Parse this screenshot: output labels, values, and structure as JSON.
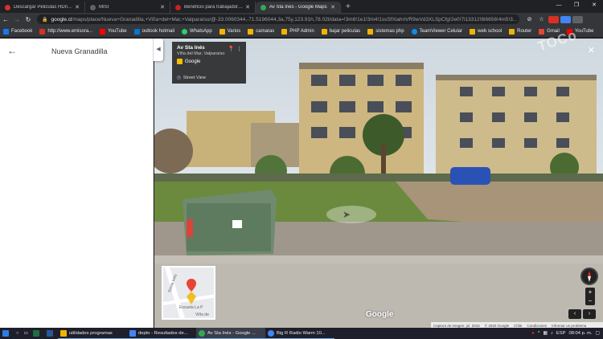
{
  "tabs": [
    {
      "label": "Descargar Peliculas HDrip por To...",
      "color": "#d93025",
      "active": false
    },
    {
      "label": "MISI",
      "color": "#5f6368",
      "active": false
    },
    {
      "label": "Beneficio para trabajadores indep...",
      "color": "#c5221f",
      "active": false
    },
    {
      "label": "Av Sta Inés - Google Maps",
      "color": "#34a853",
      "active": true
    }
  ],
  "new_tab_label": "+",
  "window_controls": {
    "minimize": "—",
    "maximize": "❐",
    "close": "✕"
  },
  "address": {
    "host": "google.cl",
    "path": "/maps/place/Nueva+Granadilla,+Viña+del+Mar,+Valparaíso/@-33.0060344,-71.5196044,3a,75y,123.91h,78.02t/data=!3m6!1e1!3m4!1ssSfXiahnVR9wVd3XLSpCfg!2e0!7i13312!8i6656!4m5!3..."
  },
  "bookmarks": [
    {
      "label": "Facebook",
      "color": "#1877f2"
    },
    {
      "label": "http://www.emisora...",
      "color": "#d93025"
    },
    {
      "label": "YouTube",
      "color": "#ff0000"
    },
    {
      "label": "outlook hotmail",
      "color": "#0078d4"
    },
    {
      "label": "WhatsApp",
      "color": "#25d366"
    },
    {
      "label": "Varios",
      "color": "#f2b400"
    },
    {
      "label": "camaras",
      "color": "#f2b400"
    },
    {
      "label": "PHP Admin",
      "color": "#f2b400"
    },
    {
      "label": "bajar peliculas",
      "color": "#f2b400"
    },
    {
      "label": "sistemas php",
      "color": "#f2b400"
    },
    {
      "label": "TeamViewer Celular",
      "color": "#0e8ee9"
    },
    {
      "label": "web school",
      "color": "#f2b400"
    },
    {
      "label": "Router",
      "color": "#f2b400"
    },
    {
      "label": "Gmail",
      "color": "#ea4335"
    },
    {
      "label": "YouTube",
      "color": "#ff0000"
    }
  ],
  "side_panel": {
    "title": "Nueva Granadilla"
  },
  "street_view_card": {
    "title": "Av Sta Inés",
    "subtitle": "Viña del Mar, Valparaíso",
    "provider": "Google",
    "mode": "Street View"
  },
  "watermark": "TOCo",
  "minimap": {
    "street_label": "Santa Inés",
    "place_label": "Escuela La P",
    "city_label": "Viña de"
  },
  "google_logo": "Google",
  "attribution": [
    "Captura de imagen: jul. 2015",
    "© 2020 Google",
    "Chile",
    "Condiciones",
    "Informar un problema"
  ],
  "zoom": {
    "in": "+",
    "out": "−"
  },
  "taskbar": {
    "items": [
      {
        "label": "utilidades programas",
        "color": "#f2b400"
      },
      {
        "label": "depto - Resultados de...",
        "color": "#4285f4"
      },
      {
        "label": "Av Sta Inés - Google ...",
        "color": "#34a853"
      },
      {
        "label": "Big R Radio Warm 10...",
        "color": "#4285f4"
      }
    ],
    "tray_lang": "ESP",
    "time": "08:04 p. m."
  }
}
